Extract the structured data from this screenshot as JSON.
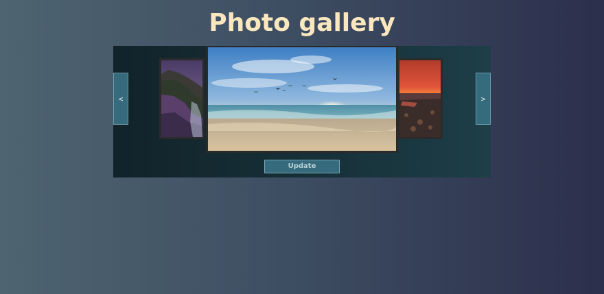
{
  "header": {
    "title": "Photo gallery"
  },
  "gallery": {
    "prev_label": "<",
    "next_label": ">",
    "update_label": "Update",
    "photos": [
      {
        "name": "cliff-coast-photo",
        "position": "previous"
      },
      {
        "name": "beach-sunrise-photo",
        "position": "current"
      },
      {
        "name": "red-sunset-photo",
        "position": "next"
      }
    ]
  },
  "colors": {
    "title": "#fbe7bd",
    "button": "#356b7c",
    "panel": "#12232a"
  }
}
